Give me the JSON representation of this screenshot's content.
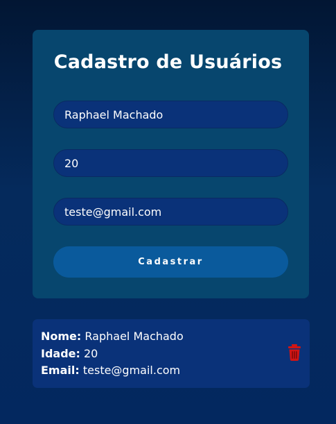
{
  "form": {
    "title": "Cadastro de Usuários",
    "name_value": "Raphael Machado",
    "age_value": "20",
    "email_value": "teste@gmail.com",
    "submit_label": "Cadastrar"
  },
  "user": {
    "name_label": "Nome:",
    "name": "Raphael Machado",
    "age_label": "Idade:",
    "age": "20",
    "email_label": "Email:",
    "email": "teste@gmail.com",
    "delete_icon": "trash-icon"
  },
  "colors": {
    "background_top": "#021633",
    "background_bottom": "#03285f",
    "card": "#07466e",
    "input": "#0a3279",
    "button": "#0a5a9c",
    "delete": "#d01515"
  }
}
